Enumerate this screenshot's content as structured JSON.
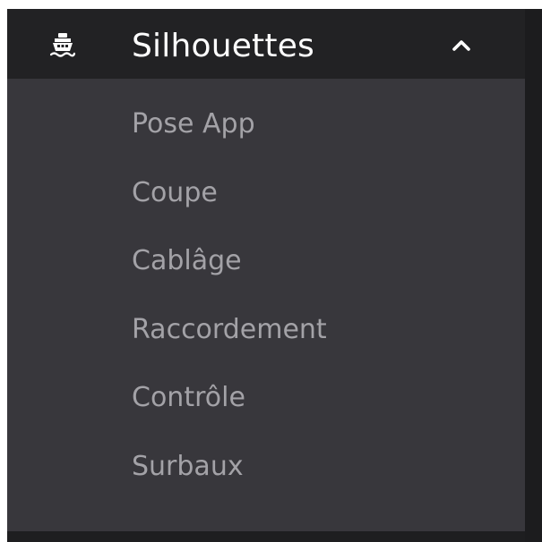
{
  "menu": {
    "icon": "ship-icon",
    "title": "Silhouettes",
    "expanded": true,
    "toggle_icon": "chevron-up-icon",
    "items": [
      {
        "label": "Pose App"
      },
      {
        "label": "Coupe"
      },
      {
        "label": "Cablâge"
      },
      {
        "label": "Raccordement"
      },
      {
        "label": "Contrôle"
      },
      {
        "label": "Surbaux"
      }
    ]
  },
  "colors": {
    "header_bg": "#222224",
    "submenu_bg": "#38373c",
    "header_text": "#ffffff",
    "item_text": "#a3a2a7"
  }
}
